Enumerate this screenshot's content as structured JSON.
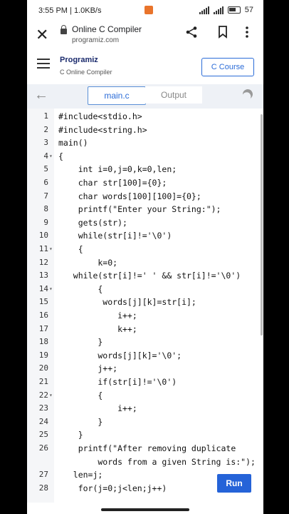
{
  "status": {
    "time": "3:55 PM",
    "speed": "1.0KB/s",
    "battery": "57"
  },
  "browser": {
    "title": "Online C Compiler",
    "url": "programiz.com"
  },
  "site": {
    "logo": "Programiz",
    "subtitle": "C Online Compiler",
    "course_button": "C Course"
  },
  "tabs": {
    "main": "main.c",
    "output": "Output"
  },
  "run_button": "Run",
  "code_lines": [
    {
      "n": "1",
      "fold": false,
      "text": "#include<stdio.h>"
    },
    {
      "n": "2",
      "fold": false,
      "text": "#include<string.h>"
    },
    {
      "n": "3",
      "fold": false,
      "text": "main()"
    },
    {
      "n": "4",
      "fold": true,
      "text": "{"
    },
    {
      "n": "5",
      "fold": false,
      "text": "    int i=0,j=0,k=0,len;"
    },
    {
      "n": "6",
      "fold": false,
      "text": "    char str[100]={0};"
    },
    {
      "n": "7",
      "fold": false,
      "text": "    char words[100][100]={0};"
    },
    {
      "n": "8",
      "fold": false,
      "text": "    printf(\"Enter your String:\");"
    },
    {
      "n": "9",
      "fold": false,
      "text": "    gets(str);"
    },
    {
      "n": "10",
      "fold": false,
      "text": "    while(str[i]!='\\0')"
    },
    {
      "n": "11",
      "fold": true,
      "text": "    {"
    },
    {
      "n": "12",
      "fold": false,
      "text": "        k=0;"
    },
    {
      "n": "13",
      "fold": false,
      "text": "   while(str[i]!=' ' && str[i]!='\\0')"
    },
    {
      "n": "14",
      "fold": true,
      "text": "        {"
    },
    {
      "n": "15",
      "fold": false,
      "text": "         words[j][k]=str[i];"
    },
    {
      "n": "16",
      "fold": false,
      "text": "            i++;"
    },
    {
      "n": "17",
      "fold": false,
      "text": "            k++;"
    },
    {
      "n": "18",
      "fold": false,
      "text": "        }"
    },
    {
      "n": "19",
      "fold": false,
      "text": "        words[j][k]='\\0';"
    },
    {
      "n": "20",
      "fold": false,
      "text": "        j++;"
    },
    {
      "n": "21",
      "fold": false,
      "text": "        if(str[i]!='\\0')"
    },
    {
      "n": "22",
      "fold": true,
      "text": "        {"
    },
    {
      "n": "23",
      "fold": false,
      "text": "            i++;"
    },
    {
      "n": "24",
      "fold": false,
      "text": "        }"
    },
    {
      "n": "25",
      "fold": false,
      "text": "    }"
    },
    {
      "n": "26",
      "fold": false,
      "text": "    printf(\"After removing duplicate"
    },
    {
      "n": "",
      "fold": false,
      "text": "        words from a given String is:\");"
    },
    {
      "n": "27",
      "fold": false,
      "text": "   len=j;"
    },
    {
      "n": "28",
      "fold": false,
      "text": "    for(j=0;j<len;j++)"
    }
  ]
}
